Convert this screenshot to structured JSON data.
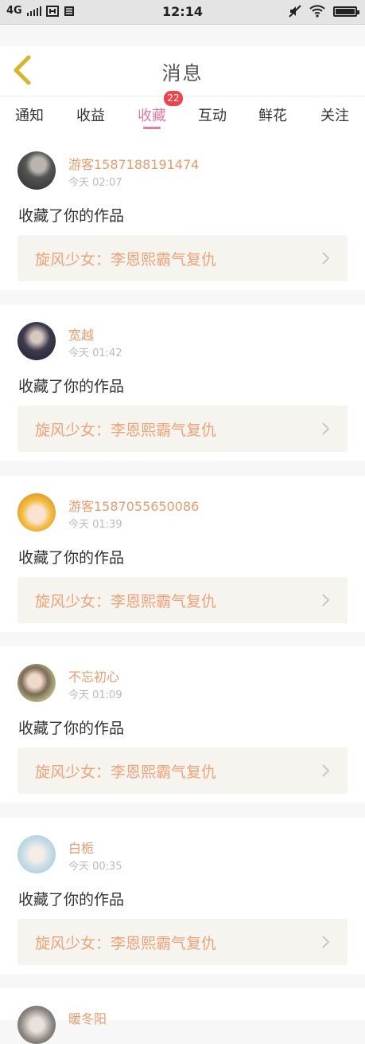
{
  "status_bar": {
    "network": "4G",
    "time": "12:14"
  },
  "header": {
    "title": "消息"
  },
  "tabs": [
    {
      "label": "通知"
    },
    {
      "label": "收益"
    },
    {
      "label": "收藏",
      "active": true,
      "badge": "22"
    },
    {
      "label": "互动"
    },
    {
      "label": "鲜花"
    },
    {
      "label": "关注"
    }
  ],
  "colors": {
    "accent_pink": "#e47aa6",
    "badge_red": "#f0434b",
    "username_orange": "#eb9a6e",
    "work_title_orange": "#efa37a",
    "back_arrow_yellow": "#d9b52e"
  },
  "messages": [
    {
      "user": "游客1587188191474",
      "time": "今天 02:07",
      "action": "收藏了你的作品",
      "work": "旋风少女：李恩熙霸气复仇"
    },
    {
      "user": "宽越",
      "time": "今天 01:42",
      "action": "收藏了你的作品",
      "work": "旋风少女：李恩熙霸气复仇"
    },
    {
      "user": "游客1587055650086",
      "time": "今天 01:39",
      "action": "收藏了你的作品",
      "work": "旋风少女：李恩熙霸气复仇"
    },
    {
      "user": "不忘初心",
      "time": "今天 01:09",
      "action": "收藏了你的作品",
      "work": "旋风少女：李恩熙霸气复仇"
    },
    {
      "user": "白栀",
      "time": "今天 00:35",
      "action": "收藏了你的作品",
      "work": "旋风少女：李恩熙霸气复仇"
    },
    {
      "user": "暖冬阳"
    }
  ]
}
